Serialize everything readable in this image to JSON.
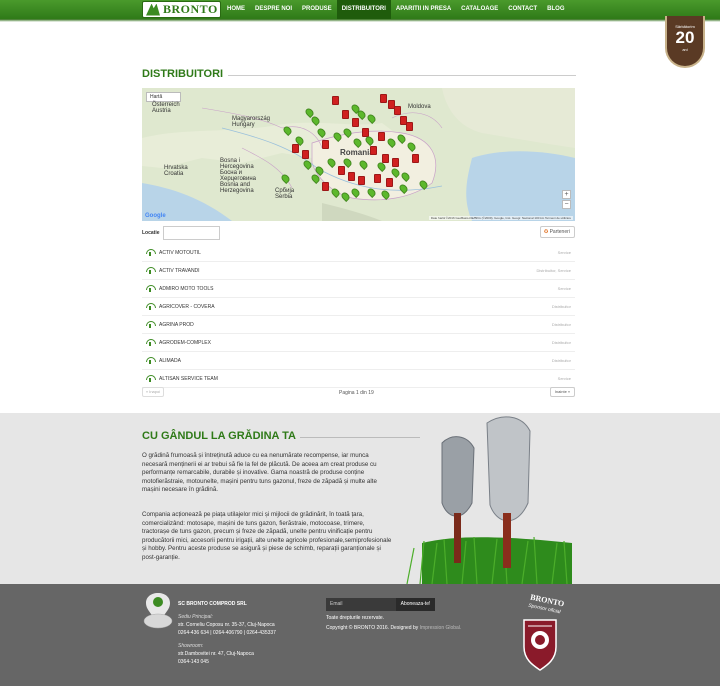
{
  "nav": {
    "logo": "BRONTO",
    "items": [
      {
        "label": "HOME"
      },
      {
        "label": "DESPRE NOI"
      },
      {
        "label": "PRODUSE"
      },
      {
        "label": "DISTRIBUITORI",
        "active": true
      },
      {
        "label": "APARITII IN PRESA"
      },
      {
        "label": "CATALOAGE"
      },
      {
        "label": "CONTACT"
      },
      {
        "label": "BLOG"
      }
    ]
  },
  "badge": {
    "top": "Sărbătorim",
    "number": "20",
    "bottom": "ani"
  },
  "distribuitori": {
    "title": "DISTRIBUITORI",
    "map": {
      "type_select": "Hartă",
      "labels": {
        "austria": "Österreich\nAustria",
        "hungary": "Magyarország\nHungary",
        "croatia": "Hrvatska\nCroatia",
        "bosnia": "Bosna i\nHercegovina\nБосна и\nХерцеговина\nBosnia and\nHerzegovina",
        "serbia": "Србија\nSerbia",
        "romania": "Romania",
        "moldova": "Moldova"
      },
      "attribution": "Date hartă ©2016 GeoBasis-DE/BKG (©2009), Google, Inst. Geogr. Nacional   100 km   Termeni de utilizare",
      "google": "Google",
      "zoom_in": "+",
      "zoom_out": "−"
    },
    "filter": {
      "label": "Locatie",
      "placeholder": "",
      "partner_button": "Parteneri"
    },
    "rows": [
      {
        "name": "ACTIV MOTOUTIL",
        "type": "Service"
      },
      {
        "name": "ACTIV TRAVANDI",
        "type": "Distribuitor, Service"
      },
      {
        "name": "ADMIRO MOTO TOOLS",
        "type": "Service"
      },
      {
        "name": "AGRICOVER - COVERA",
        "type": "Distribuitor"
      },
      {
        "name": "AGRINA PROD",
        "type": "Distribuitor"
      },
      {
        "name": "AGRODEM-COMPLEX",
        "type": "Distribuitor"
      },
      {
        "name": "ALIMADA",
        "type": "Distribuitor"
      },
      {
        "name": "ALTISAN SERVICE TEAM",
        "type": "Service"
      }
    ],
    "pagination": {
      "prev": "« Inapoi",
      "info": "Pagina 1 din 19",
      "next": "Inainte »"
    }
  },
  "garden": {
    "title": "CU GÂNDUL LA GRĂDINA TA",
    "p1": "O grădină frumoasă și întreținută aduce cu ea nenumărate recompense, iar munca necesară menținerii ei ar trebui să fie la fel de plăcută. De aceea am creat produse cu performanțe remarcabile, durabile și inovative. Gama noastră de produse conține motofierăstraie, motounelte, mașini pentru tuns gazonul, freze de zăpadă și multe alte mașini necesare în grădină.",
    "p2": "Compania acționează pe piața utilajelor mici și mijlocii de grădinărit, în toată țara, comercializând: motosape, mașini de tuns gazon, fierăstraie, motocoase, trimere, tractorașe de tuns gazon, precum și freze de zăpadă, unelte pentru vinificație pentru producătorii mici, accesorii pentru irigații, alte unelte agricole profesionale,semiprofesionale și hobby. Pentru aceste produse se asigură și piese de schimb, reparații garanționale și post-garanție."
  },
  "footer": {
    "company": "SC BRONTO COMPROD SRL",
    "sediu_label": "Sediu Principal:",
    "sediu_address": "str. Corneliu Coposu nr. 35-37, Cluj-Napoca",
    "sediu_phones": "0264-436 634 | 0264-406790 | 0264-435337",
    "showroom_label": "Showroom:",
    "showroom_address": "str.Dambovitei nr. 47, Cluj-Napoca",
    "showroom_phone": "0364-143 045",
    "newsletter_placeholder": "Email",
    "newsletter_button": "Aboneaza-te!",
    "rights": "Toate drepturile rezervate.",
    "copyright": "Copyright © BRONTO 2016. Designed by ",
    "designer": "Impression Global.",
    "sponsor_brand": "BRONTO",
    "sponsor_text": "Sponsor oficial"
  },
  "colors": {
    "brand_green": "#2f7a18",
    "footer_gray": "#666666",
    "garden_gray": "#e6e6e6"
  }
}
